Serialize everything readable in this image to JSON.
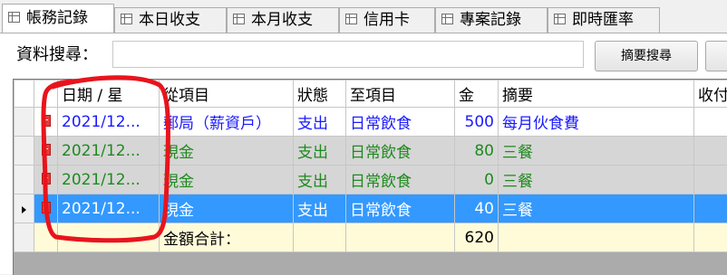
{
  "tabs": [
    {
      "label": "帳務記錄",
      "active": true
    },
    {
      "label": "本日收支"
    },
    {
      "label": "本月收支"
    },
    {
      "label": "信用卡"
    },
    {
      "label": "專案記錄"
    },
    {
      "label": "即時匯率"
    }
  ],
  "search": {
    "label": "資料搜尋：",
    "value": "",
    "button_label": "摘要搜尋"
  },
  "grid": {
    "columns": [
      "日期 / 星",
      "從項目",
      "狀態",
      "至項目",
      "金",
      "摘要",
      "收付"
    ],
    "rows": [
      {
        "date": "2021/12...",
        "from": "郵局（薪資戶）",
        "status": "支出",
        "to": "日常飲食",
        "amount": "500",
        "summary": "每月伙食費",
        "style": "blue"
      },
      {
        "date": "2021/12...",
        "from": "現金",
        "status": "支出",
        "to": "日常飲食",
        "amount": "80",
        "summary": "三餐",
        "style": "green"
      },
      {
        "date": "2021/12...",
        "from": "現金",
        "status": "支出",
        "to": "日常飲食",
        "amount": "0",
        "summary": "三餐",
        "style": "green"
      },
      {
        "date": "2021/12...",
        "from": "現金",
        "status": "支出",
        "to": "日常飲食",
        "amount": "40",
        "summary": "三餐",
        "style": "sel"
      }
    ],
    "total": {
      "label": "金額合計：",
      "amount": "620"
    }
  },
  "colors": {
    "selection": "#3399ff",
    "blue_text": "#1a1aff",
    "green_text": "#1e8a1e",
    "annotation": "#e8141c",
    "total_bg": "#fffbd9"
  }
}
